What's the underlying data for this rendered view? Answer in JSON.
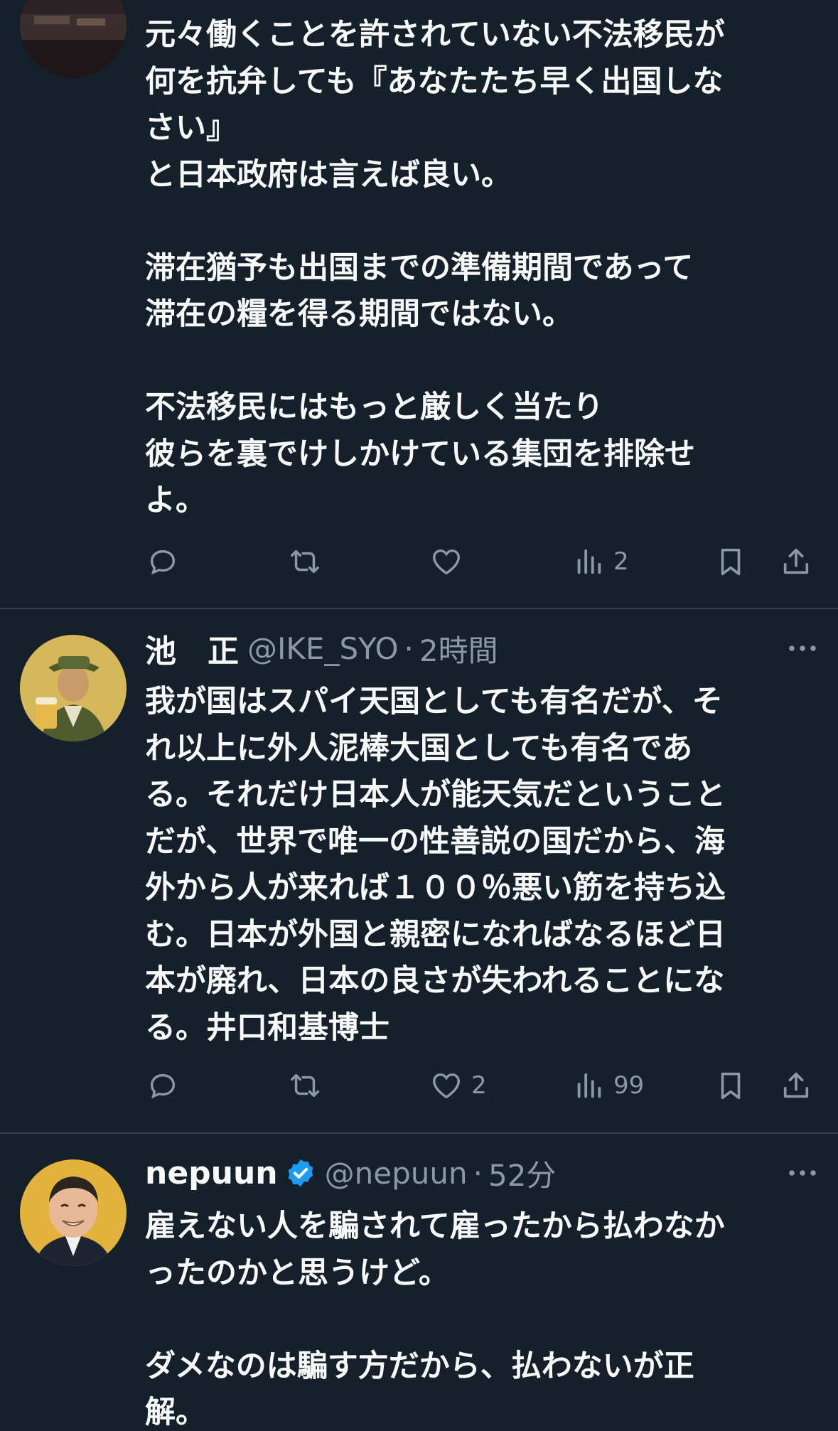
{
  "tweets": [
    {
      "text": "元々働くことを許されていない不法移民が\n何を抗弁しても『あなたたち早く出国しな\nさい』\nと日本政府は言えば良い。\n\n滞在猶予も出国までの準備期間であって\n滞在の糧を得る期間ではない。\n\n不法移民にはもっと厳しく当たり\n彼らを裏でけしかけている集団を排除せ\nよ。",
      "likes": "",
      "views": "2"
    },
    {
      "name": "池　正",
      "handle": "@IKE_SYO",
      "sep": "·",
      "time": "2時間",
      "text": "我が国はスパイ天国としても有名だが、そ\nれ以上に外人泥棒大国としても有名であ\nる。それだけ日本人が能天気だということ\nだが、世界で唯一の性善説の国だから、海\n外から人が来れば１００％悪い筋を持ち込\nむ。日本が外国と親密になればなるほど日\n本が廃れ、日本の良さが失われることにな\nる。井口和基博士",
      "likes": "2",
      "views": "99"
    },
    {
      "name": "nepuun",
      "verified": true,
      "handle": "@nepuun",
      "sep": "·",
      "time": "52分",
      "text": "雇えない人を騙されて雇ったから払わなか\nったのかと思うけど。\n\nダメなのは騙す方だから、払わないが正\n解。"
    }
  ],
  "icons": {
    "reply": "reply-icon",
    "retweet": "retweet-icon",
    "like": "heart-icon",
    "views": "analytics-icon",
    "bookmark": "bookmark-icon",
    "share": "share-icon",
    "more": "more-icon",
    "verified": "verified-badge-icon"
  },
  "colors": {
    "background": "#15202b",
    "text": "#f7f9f9",
    "secondary": "#8b98a5",
    "divider": "#38444d",
    "verified": "#1d9bf0"
  }
}
